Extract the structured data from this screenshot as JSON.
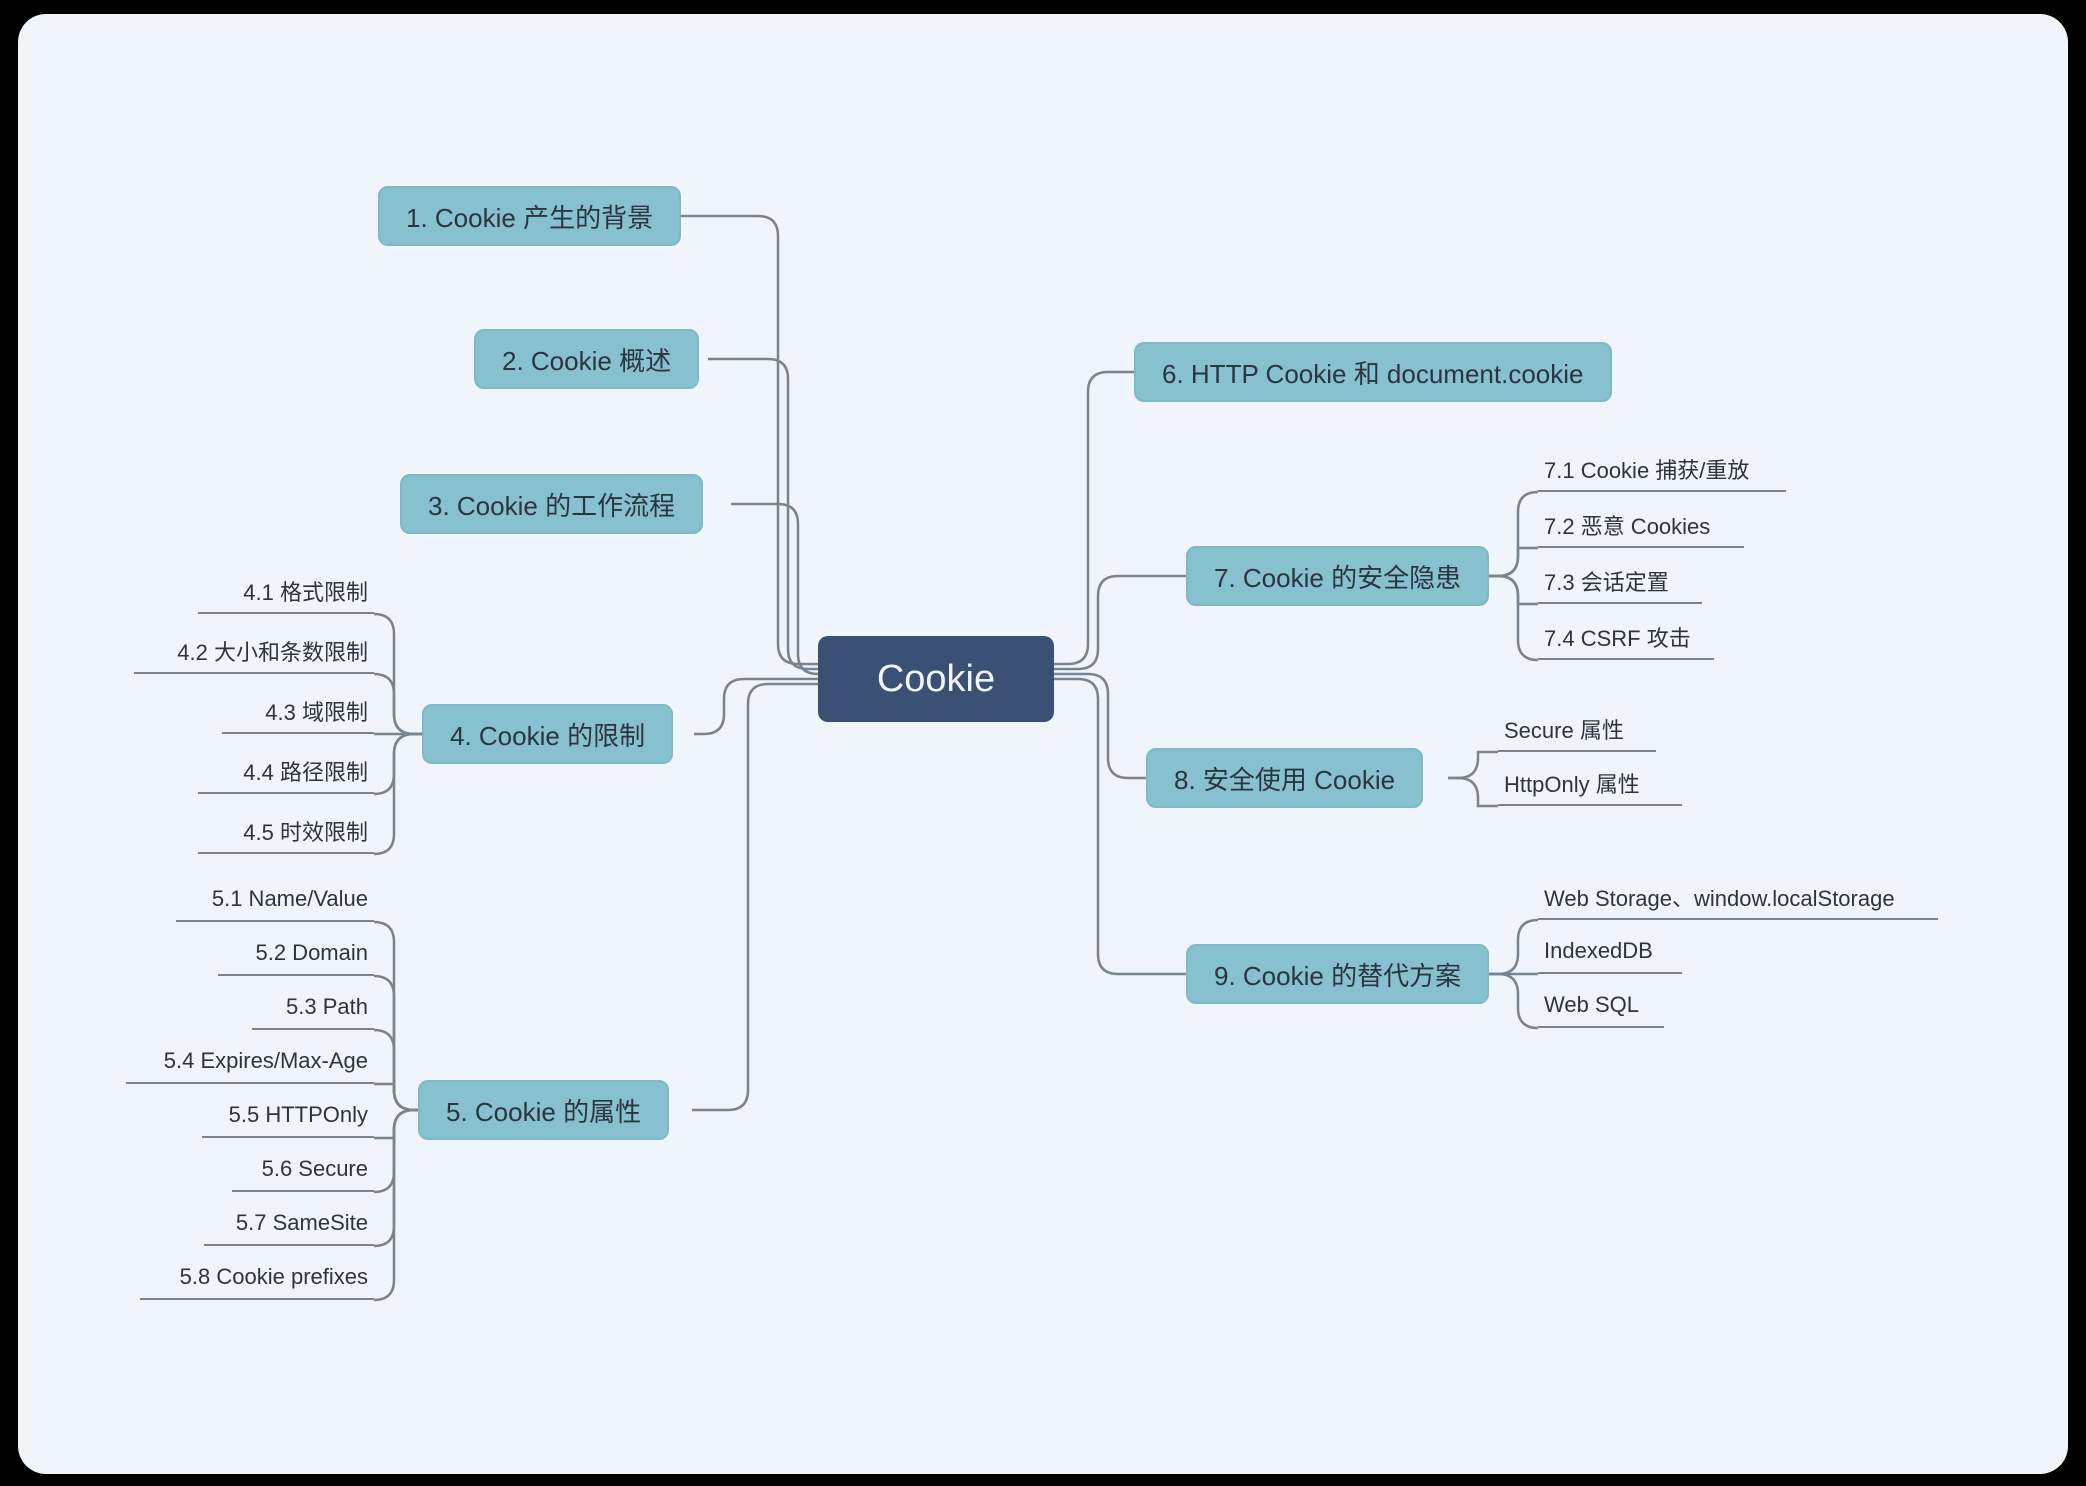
{
  "root": "Cookie",
  "left": {
    "b1": "1. Cookie 产生的背景",
    "b2": "2. Cookie 概述",
    "b3": "3. Cookie 的工作流程",
    "b4": "4. Cookie 的限制",
    "b4_leaves": {
      "l1": "4.1 格式限制",
      "l2": "4.2 大小和条数限制",
      "l3": "4.3 域限制",
      "l4": "4.4 路径限制",
      "l5": "4.5 时效限制"
    },
    "b5": "5. Cookie 的属性",
    "b5_leaves": {
      "l1": "5.1 Name/Value",
      "l2": "5.2 Domain",
      "l3": "5.3 Path",
      "l4": "5.4 Expires/Max-Age",
      "l5": "5.5 HTTPOnly",
      "l6": "5.6 Secure",
      "l7": "5.7 SameSite",
      "l8": "5.8 Cookie prefixes"
    }
  },
  "right": {
    "b6": "6. HTTP Cookie 和 document.cookie",
    "b7": "7. Cookie 的安全隐患",
    "b7_leaves": {
      "l1": "7.1 Cookie 捕获/重放",
      "l2": "7.2 恶意 Cookies",
      "l3": "7.3 会话定置",
      "l4": "7.4 CSRF 攻击"
    },
    "b8": "8. 安全使用 Cookie",
    "b8_leaves": {
      "l1": "Secure 属性",
      "l2": "HttpOnly 属性"
    },
    "b9": "9. Cookie 的替代方案",
    "b9_leaves": {
      "l1": "Web Storage、window.localStorage",
      "l2": "IndexedDB",
      "l3": "Web SQL"
    }
  },
  "colors": {
    "bg": "#eff5fb",
    "root": "#3a5075",
    "branch": "#87c0cf",
    "line": "#788590",
    "text": "#2b3540"
  }
}
